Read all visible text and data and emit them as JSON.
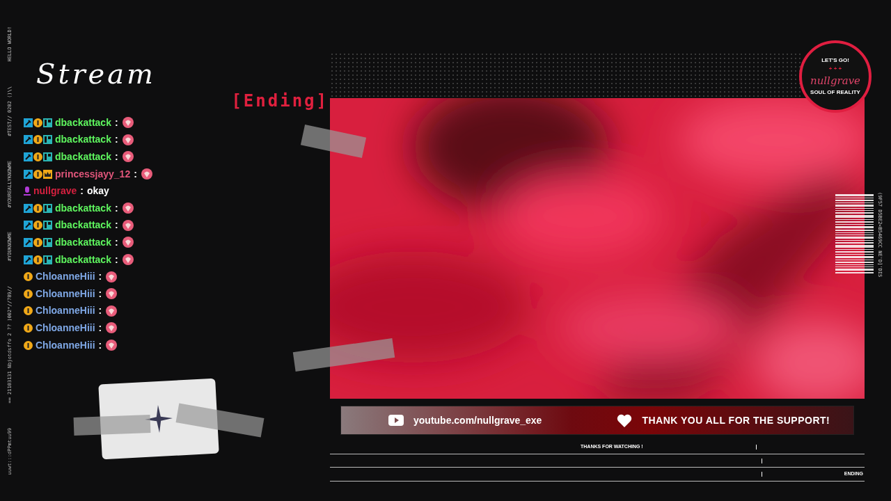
{
  "side_texts": [
    "HELLO WORLD!",
    "#TEST// 0202 ()\\\\",
    "#YOUREALLYKNOWME",
    "#YOUKNOWME",
    "== 21103131 Nbjotdsffo 2 ?? )002*//789//",
    "uuwt:::dPPmtuu99"
  ],
  "title": {
    "script": "Stream",
    "pixel": "[Ending]"
  },
  "chat": [
    {
      "user": "dbackattack",
      "sep": ":",
      "color": "#5ef55e",
      "badges": [
        {
          "kind": "mod"
        },
        {
          "kind": "sub"
        },
        {
          "kind": "gift"
        }
      ]
    },
    {
      "user": "dbackattack",
      "sep": ":",
      "color": "#5ef55e",
      "badges": [
        {
          "kind": "mod"
        },
        {
          "kind": "sub"
        },
        {
          "kind": "gift"
        }
      ]
    },
    {
      "user": "dbackattack",
      "sep": ":",
      "color": "#5ef55e",
      "badges": [
        {
          "kind": "mod"
        },
        {
          "kind": "sub"
        },
        {
          "kind": "gift"
        }
      ]
    },
    {
      "user": "princessjayy_12",
      "sep": ":",
      "color": "#e0557a",
      "badges": [
        {
          "kind": "mod"
        },
        {
          "kind": "sub"
        },
        {
          "kind": "crown"
        }
      ]
    },
    {
      "user": "nullgrave",
      "sep": ":",
      "color": "#d6203f",
      "badges": [
        {
          "kind": "mic"
        }
      ],
      "text": "okay"
    },
    {
      "user": "dbackattack",
      "sep": ":",
      "color": "#5ef55e",
      "badges": [
        {
          "kind": "mod"
        },
        {
          "kind": "sub"
        },
        {
          "kind": "gift"
        }
      ]
    },
    {
      "user": "dbackattack",
      "sep": ":",
      "color": "#5ef55e",
      "badges": [
        {
          "kind": "mod"
        },
        {
          "kind": "sub"
        },
        {
          "kind": "gift"
        }
      ]
    },
    {
      "user": "dbackattack",
      "sep": ":",
      "color": "#5ef55e",
      "badges": [
        {
          "kind": "mod"
        },
        {
          "kind": "sub"
        },
        {
          "kind": "gift"
        }
      ]
    },
    {
      "user": "dbackattack",
      "sep": ":",
      "color": "#5ef55e",
      "badges": [
        {
          "kind": "mod"
        },
        {
          "kind": "sub"
        },
        {
          "kind": "gift"
        }
      ]
    },
    {
      "user": "ChloanneHiii",
      "sep": ":",
      "color": "#7fa8e6",
      "badges": [
        {
          "kind": "sub"
        }
      ]
    },
    {
      "user": "ChloanneHiii",
      "sep": ":",
      "color": "#7fa8e6",
      "badges": [
        {
          "kind": "sub"
        }
      ]
    },
    {
      "user": "ChloanneHiii",
      "sep": ":",
      "color": "#7fa8e6",
      "badges": [
        {
          "kind": "sub"
        }
      ]
    },
    {
      "user": "ChloanneHiii",
      "sep": ":",
      "color": "#7fa8e6",
      "badges": [
        {
          "kind": "sub"
        }
      ]
    },
    {
      "user": "ChloanneHiii",
      "sep": ":",
      "color": "#7fa8e6",
      "badges": [
        {
          "kind": "sub"
        }
      ]
    }
  ],
  "logo": {
    "top": "LET'S GO!",
    "marks": "+ + +",
    "name": "nullgrave",
    "tagline": "SOUL OF REALITY"
  },
  "barcode_text": "(9F57 D5BE2<B5469CC NE'D]'DIS",
  "banner": {
    "link": "youtube.com/nullgrave_exe",
    "message": "THANK YOU ALL FOR THE SUPPORT!"
  },
  "footer": {
    "center": "THANKS FOR WATCHING !",
    "right": "ENDING"
  }
}
